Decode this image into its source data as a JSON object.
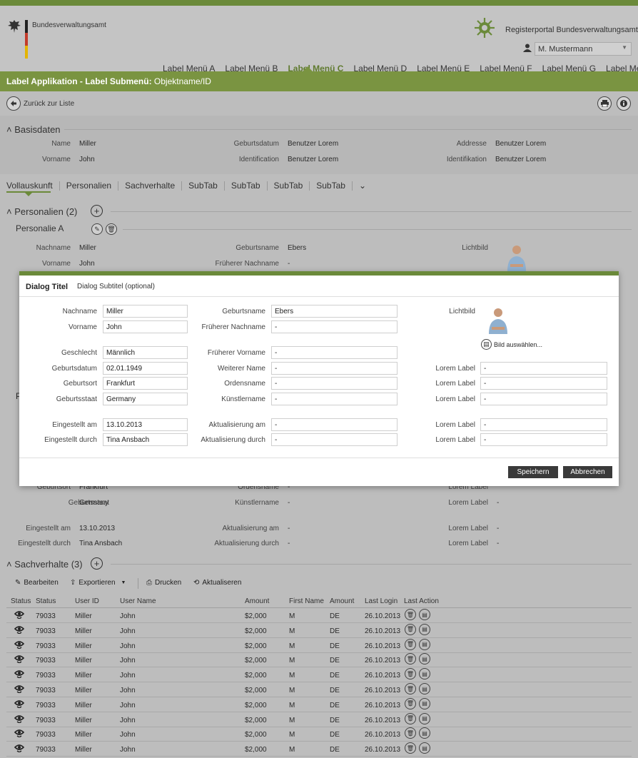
{
  "header": {
    "org_name": "Bundesverwaltungsamt",
    "portal": "Registerportal  Bundesverwaltungsamt",
    "user": "M. Mustermann",
    "nav": [
      "Label Menü A",
      "Label Menü B",
      "Label Menü C",
      "Label Menü  D",
      "Label Menü E",
      "Label Menü F",
      "Label Menü G",
      "Label Menü H"
    ],
    "active_nav": "Label Menü C"
  },
  "appbar": {
    "path_bold": "Label Applikation - Label Submenü:",
    "path_rest": " Objektname/ID"
  },
  "back": {
    "label": "Zurück zur Liste"
  },
  "basisdaten": {
    "title": "Basisdaten",
    "fields": [
      {
        "label": "Name",
        "value": "Miller"
      },
      {
        "label": "Vorname",
        "value": "John"
      },
      {
        "label": "Geburtsdatum",
        "value": "Benutzer Lorem"
      },
      {
        "label": "Identification",
        "value": "Benutzer Lorem"
      },
      {
        "label": "Addresse",
        "value": "Benutzer Lorem"
      },
      {
        "label": "Identifikation",
        "value": "Benutzer Lorem"
      }
    ]
  },
  "tabs": [
    "Vollauskunft",
    "Personalien",
    "Sachverhalte",
    "SubTab",
    "SubTab",
    "SubTab",
    "SubTab"
  ],
  "personalien": {
    "title": "Personalien (2)",
    "sub_title": "Personalie A",
    "fields": [
      {
        "label": "Nachname",
        "value": "Miller"
      },
      {
        "label": "Vorname",
        "value": "John"
      },
      {
        "label": "Geburtsname",
        "value": "Ebers"
      },
      {
        "label": "Früherer Nachname",
        "value": "-"
      },
      {
        "label": "Lichtbild",
        "value": ""
      }
    ],
    "lower_fields": [
      {
        "label": "Geburtsort",
        "value": "Frankfurt"
      },
      {
        "label": "Geburtsstaat",
        "value": "Germany"
      },
      {
        "label": "Eingestellt am",
        "value": "13.10.2013"
      },
      {
        "label": "Eingestellt durch",
        "value": "Tina Ansbach"
      },
      {
        "label": "Ordensname",
        "value": "-"
      },
      {
        "label": "Künstlername",
        "value": "-"
      },
      {
        "label": "Aktualisierung am",
        "value": "-"
      },
      {
        "label": "Aktualisierung durch",
        "value": "-"
      },
      {
        "label": "Lorem Label",
        "value": "-"
      }
    ],
    "behind_letter": "P"
  },
  "dialog": {
    "title": "Dialog Titel",
    "subtitle": "Dialog Subtitel (optional)",
    "col1": [
      {
        "label": "Nachname",
        "value": "Miller"
      },
      {
        "label": "Vorname",
        "value": "John"
      },
      {
        "label": "Geschlecht",
        "value": "Männlich"
      },
      {
        "label": "Geburtsdatum",
        "value": "02.01.1949"
      },
      {
        "label": "Geburtsort",
        "value": "Frankfurt"
      },
      {
        "label": "Geburtsstaat",
        "value": "Germany"
      },
      {
        "label": "Eingestellt am",
        "value": "13.10.2013"
      },
      {
        "label": "Eingestellt durch",
        "value": "Tina Ansbach"
      }
    ],
    "col2": [
      {
        "label": "Geburtsname",
        "value": "Ebers"
      },
      {
        "label": "Früherer Nachname",
        "value": "-"
      },
      {
        "label": "Früherer Vorname",
        "value": "-"
      },
      {
        "label": "Weiterer Name",
        "value": "-"
      },
      {
        "label": "Ordensname",
        "value": "-"
      },
      {
        "label": "Künstlername",
        "value": "-"
      },
      {
        "label": "Aktualisierung am",
        "value": "-"
      },
      {
        "label": "Aktualisierung durch",
        "value": "-"
      }
    ],
    "col3_label_photo": "Lichtbild",
    "choose_image": "Bild auswählen...",
    "col3": [
      {
        "label": "Lorem Label",
        "value": "-"
      },
      {
        "label": "Lorem Label",
        "value": "-"
      },
      {
        "label": "Lorem Label",
        "value": "-"
      },
      {
        "label": "Lorem Label",
        "value": "-"
      },
      {
        "label": "Lorem Label",
        "value": "-"
      }
    ],
    "save": "Speichern",
    "cancel": "Abbrechen"
  },
  "sachverhalte": {
    "title": "Sachverhalte (3)",
    "toolbar": [
      "Bearbeiten",
      "Exportieren",
      "Drucken",
      "Aktualiseren"
    ],
    "columns": [
      "Status",
      "Status",
      "User ID",
      "User Name",
      "Amount",
      "First Name",
      "Amount",
      "Last Login",
      "Last Action"
    ],
    "rows": [
      [
        "79033",
        "Miller",
        "John",
        "$2,000",
        "M",
        "DE",
        "26.10.2013"
      ],
      [
        "79033",
        "Miller",
        "John",
        "$2,000",
        "M",
        "DE",
        "26.10.2013"
      ],
      [
        "79033",
        "Miller",
        "John",
        "$2,000",
        "M",
        "DE",
        "26.10.2013"
      ],
      [
        "79033",
        "Miller",
        "John",
        "$2,000",
        "M",
        "DE",
        "26.10.2013"
      ],
      [
        "79033",
        "Miller",
        "John",
        "$2,000",
        "M",
        "DE",
        "26.10.2013"
      ],
      [
        "79033",
        "Miller",
        "John",
        "$2,000",
        "M",
        "DE",
        "26.10.2013"
      ],
      [
        "79033",
        "Miller",
        "John",
        "$2,000",
        "M",
        "DE",
        "26.10.2013"
      ],
      [
        "79033",
        "Miller",
        "John",
        "$2,000",
        "M",
        "DE",
        "26.10.2013"
      ],
      [
        "79033",
        "Miller",
        "John",
        "$2,000",
        "M",
        "DE",
        "26.10.2013"
      ],
      [
        "79033",
        "Miller",
        "John",
        "$2,000",
        "M",
        "DE",
        "26.10.2013"
      ]
    ]
  },
  "colors": {
    "brand_green": "#6b8a3a",
    "appbar_green": "#7a9441",
    "overlay_gray": "#bdbdbd",
    "button_dark": "#3a3a3a"
  }
}
